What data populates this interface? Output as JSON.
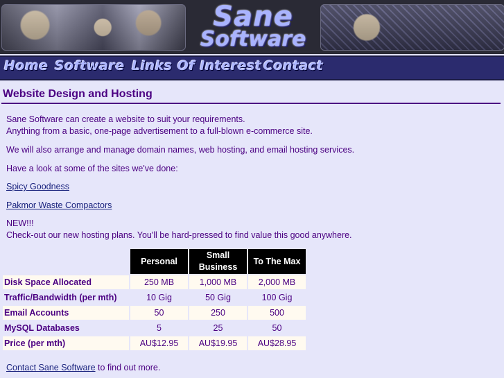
{
  "header": {
    "logo_line1": "Sane",
    "logo_line2": "Software"
  },
  "nav": {
    "items": [
      {
        "label": "Home"
      },
      {
        "label": "Software"
      },
      {
        "label": "Links Of Interest"
      },
      {
        "label": "Contact"
      }
    ]
  },
  "main": {
    "title": "Website Design and Hosting",
    "intro_line1": "Sane Software can create a website to suit your requirements.",
    "intro_line2": "Anything from a basic, one-page advertisement to a full-blown e-commerce site.",
    "domains_text": "We will also arrange and manage domain names, web hosting, and email hosting services.",
    "sites_text": "Have a look at some of the sites we've done:",
    "site_links": [
      "Spicy Goodness",
      "Pakmor Waste Compactors"
    ],
    "new_label": "NEW!!!",
    "hosting_text": "Check-out our new hosting plans. You'll be hard-pressed to find value this good anywhere.",
    "contact_link": "Contact Sane Software",
    "contact_suffix": " to find out more."
  },
  "plans_table": {
    "columns": [
      "Personal",
      "Small Business",
      "To The Max"
    ],
    "rows": [
      {
        "label": "Disk Space Allocated",
        "values": [
          "250 MB",
          "1,000 MB",
          "2,000 MB"
        ]
      },
      {
        "label": "Traffic/Bandwidth (per mth)",
        "values": [
          "10 Gig",
          "50 Gig",
          "100 Gig"
        ]
      },
      {
        "label": "Email Accounts",
        "values": [
          "50",
          "250",
          "500"
        ]
      },
      {
        "label": "MySQL Databases",
        "values": [
          "5",
          "25",
          "50"
        ]
      },
      {
        "label": "Price (per mth)",
        "values": [
          "AU$12.95",
          "AU$19.95",
          "AU$28.95"
        ]
      }
    ]
  },
  "colors": {
    "background": "#e6e6fa",
    "text": "#4b0082",
    "nav_bar": "#2b2b6e",
    "link": "#1a237e"
  }
}
